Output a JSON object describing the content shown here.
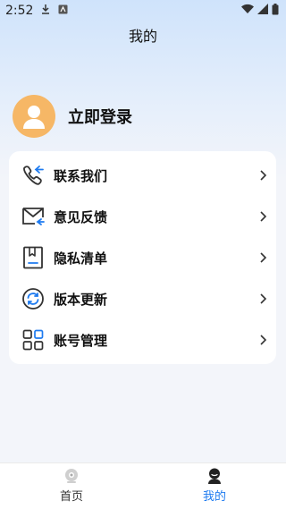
{
  "status_bar": {
    "time": "2:52"
  },
  "header": {
    "title": "我的"
  },
  "profile": {
    "login_label": "立即登录"
  },
  "menu": {
    "items": [
      {
        "label": "联系我们",
        "icon": "phone-icon"
      },
      {
        "label": "意见反馈",
        "icon": "mail-icon"
      },
      {
        "label": "隐私清单",
        "icon": "bookmark-document-icon"
      },
      {
        "label": "版本更新",
        "icon": "refresh-icon"
      },
      {
        "label": "账号管理",
        "icon": "grid-icon"
      }
    ]
  },
  "tabs": [
    {
      "label": "首页",
      "icon": "home-tab-icon",
      "active": false
    },
    {
      "label": "我的",
      "icon": "profile-tab-icon",
      "active": true
    }
  ],
  "colors": {
    "accent": "#1e7bf0",
    "avatar": "#f6b766"
  }
}
